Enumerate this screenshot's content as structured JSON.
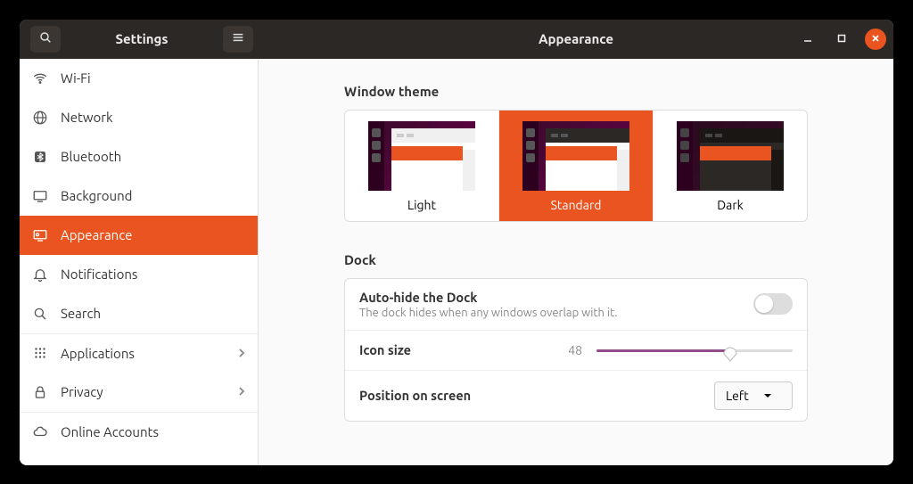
{
  "app_title": "Settings",
  "page_title": "Appearance",
  "sidebar": {
    "items": [
      {
        "label": "Wi-Fi"
      },
      {
        "label": "Network"
      },
      {
        "label": "Bluetooth"
      },
      {
        "label": "Background"
      },
      {
        "label": "Appearance",
        "active": true
      },
      {
        "label": "Notifications"
      },
      {
        "label": "Search"
      },
      {
        "label": "Applications",
        "separator": true,
        "chevron": true
      },
      {
        "label": "Privacy",
        "chevron": true
      },
      {
        "label": "Online Accounts",
        "separator": true
      }
    ]
  },
  "window_theme": {
    "section_title": "Window theme",
    "options": [
      {
        "label": "Light"
      },
      {
        "label": "Standard",
        "selected": true
      },
      {
        "label": "Dark"
      }
    ]
  },
  "dock": {
    "section_title": "Dock",
    "autohide": {
      "title": "Auto-hide the Dock",
      "subtitle": "The dock hides when any windows overlap with it.",
      "value": false
    },
    "icon_size": {
      "title": "Icon size",
      "value": "48",
      "min": 16,
      "max": 64
    },
    "position": {
      "title": "Position on screen",
      "value": "Left"
    }
  }
}
